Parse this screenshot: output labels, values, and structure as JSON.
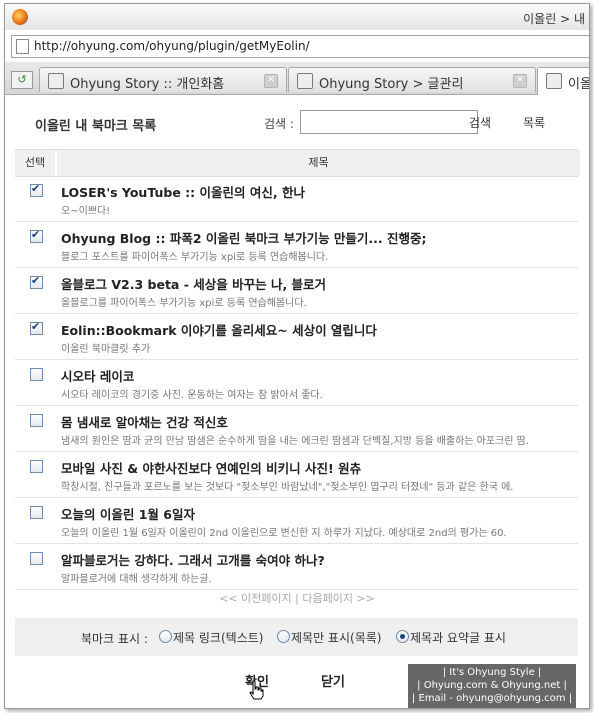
{
  "browser": {
    "window_title": "이올린 > 내",
    "url": "http://ohyung.com/ohyung/plugin/getMyEolin/",
    "tabs": [
      {
        "label": "Ohyung Story :: 개인화홈"
      },
      {
        "label": "Ohyung Story > 글관리"
      },
      {
        "label": "이올"
      }
    ]
  },
  "header": {
    "title": "이올린 내 북마크 목록",
    "search_label": "검색 :",
    "search_value": "",
    "search_button": "검색",
    "list_button": "목록"
  },
  "table": {
    "col_select": "선택",
    "col_title": "제목",
    "rows": [
      {
        "checked": true,
        "title": "LOSER's YouTube :: 이올린의 여신, 한나",
        "desc": "오~이쁘다!"
      },
      {
        "checked": true,
        "title": "Ohyung Blog :: 파폭2 이올린 북마크 부가기능 만들기... 진행중;",
        "desc": "블로그 포스트를 파이어폭스 부가기능 xpi로 등록 연습해봅니다."
      },
      {
        "checked": true,
        "title": "올블로그 V2.3 beta - 세상을 바꾸는 나, 블로거",
        "desc": "올블로그를 파이어폭스 부가기능 xpi로 등록 연습해봅니다."
      },
      {
        "checked": true,
        "title": "Eolin::Bookmark 이야기를 올리세요~ 세상이 열립니다",
        "desc": "이올린 북마클릿 추가"
      },
      {
        "checked": false,
        "title": "시오타 레이코",
        "desc": "시오타 레이코의 경기중 사진. 운동하는 여자는 참 밝아서 좋다."
      },
      {
        "checked": false,
        "title": "몸 냄새로 알아채는 건강 적신호",
        "desc": "냄새의 원인은 땀과 균의 만남 땀샘은 순수하게 땀을 내는 에크린 땀샘과 단백질,지방 등을 배출하는 아포크린 땀."
      },
      {
        "checked": false,
        "title": "모바일 사진 & 야한사진보다 연예인의 비키니 사진! 원츄",
        "desc": "학창시절, 친구들과 포르노를 보는 것보다 \"젖소부인 바람났네\",\"젖소부인 엽구리 터졌네\" 등과 같은 한국 에."
      },
      {
        "checked": false,
        "title": "오늘의 이올린 1월 6일자",
        "desc": "오늘의 이올린 1월 6일자 이올린이 2nd 이올린으로 변신한 지 하루가 지났다. 예상대로 2nd의 평가는 60."
      },
      {
        "checked": false,
        "title": "알파블로거는 강하다. 그래서 고개를 숙여야 하나?",
        "desc": "알파블로거에 대해 생각하게 하는글."
      }
    ]
  },
  "pager": "<< 이전페이지 | 다음페이지 >>",
  "display_options": {
    "label": "북마크 표시 :",
    "options": [
      {
        "text": "제목 링크(텍스트)",
        "selected": false
      },
      {
        "text": "제목만 표시(목록)",
        "selected": false
      },
      {
        "text": "제목과 요약글 표시",
        "selected": true
      }
    ]
  },
  "buttons": {
    "confirm": "확인",
    "close": "닫기"
  },
  "watermark": {
    "line1": "| It's Ohyung Style |",
    "line2": "| Ohyung.com & Ohyung.net |",
    "line3": "| Email - ohyung@ohyung.com |"
  }
}
